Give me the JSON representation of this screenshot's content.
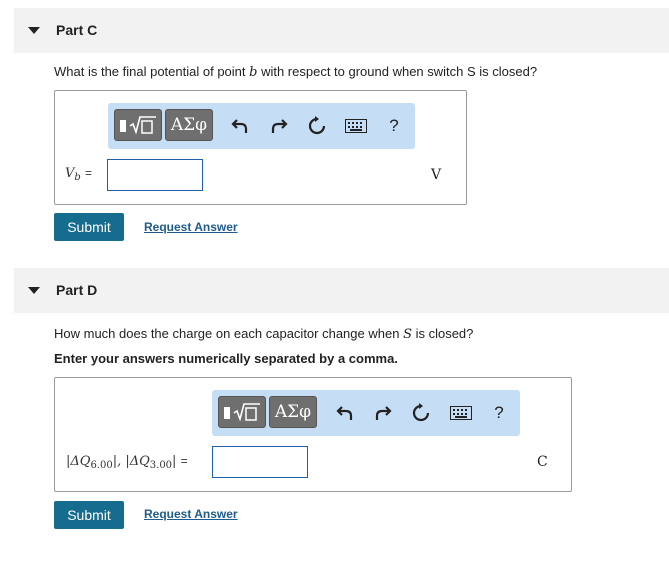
{
  "part_c": {
    "title": "Part C",
    "question_before": "What is the final potential of point ",
    "question_var": "b",
    "question_after": " with respect to ground when switch S is closed?",
    "toolbar": {
      "templates_label": "√□",
      "greek_label": "ΑΣφ",
      "help_label": "?"
    },
    "var_symbol": "V",
    "var_sub": "b",
    "equals": "=",
    "input_value": "",
    "unit": "V",
    "submit_label": "Submit",
    "request_label": "Request Answer"
  },
  "part_d": {
    "title": "Part D",
    "question_before": "How much does the charge on each capacitor change when ",
    "question_var": "S",
    "question_after": " is closed?",
    "instruction": "Enter your answers numerically separated by a comma.",
    "toolbar": {
      "templates_label": "√□",
      "greek_label": "ΑΣφ",
      "help_label": "?"
    },
    "var1_prefix": "|ΔQ",
    "var1_sub": "6.00",
    "var_sep": "|, |ΔQ",
    "var2_sub": "3.00",
    "var_suffix": "|",
    "equals": "=",
    "input_value": "",
    "unit": "C",
    "submit_label": "Submit",
    "request_label": "Request Answer"
  }
}
